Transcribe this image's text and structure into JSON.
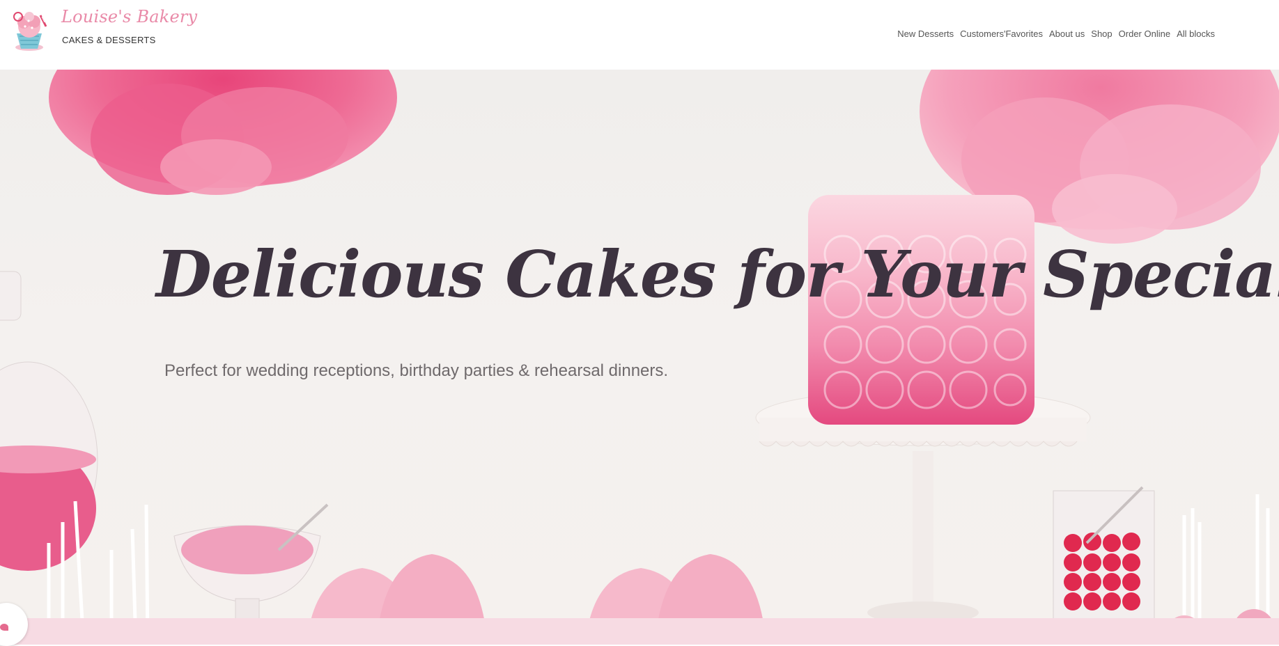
{
  "brand": {
    "name": "Louise's Bakery",
    "tagline": "CAKES & DESSERTS",
    "logo_icon": "cupcake-logo-icon"
  },
  "nav": {
    "items": [
      {
        "label": "New Desserts"
      },
      {
        "label": "Customers'Favorites"
      },
      {
        "label": "About us"
      },
      {
        "label": "Shop"
      },
      {
        "label": "Order Online"
      },
      {
        "label": "All blocks"
      }
    ]
  },
  "hero": {
    "title": "Delicious Cakes for Your Special Event",
    "subtitle": "Perfect for wedding receptions, birthday parties & rehearsal dinners."
  },
  "floating_button": {
    "icon": "chat-icon"
  },
  "colors": {
    "brand_pink": "#e98aa8",
    "title_color": "#3d3340",
    "subtitle_color": "#6f6a6c",
    "nav_text": "#555555"
  }
}
